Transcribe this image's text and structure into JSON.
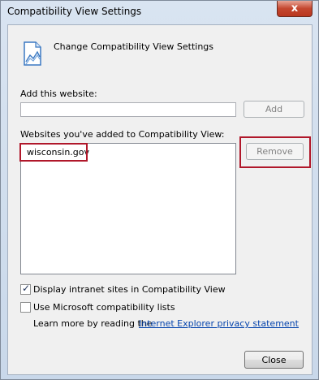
{
  "window": {
    "title": "Compatibility View Settings",
    "close_glyph": "x"
  },
  "header": {
    "icon": "compatibility-icon",
    "title": "Change Compatibility View Settings"
  },
  "add_website": {
    "label": "Add this website:",
    "value": "",
    "add_button": "Add"
  },
  "websites": {
    "label": "Websites you've added to Compatibility View:",
    "items": [
      "wisconsin.gov"
    ],
    "remove_button": "Remove"
  },
  "options": {
    "intranet": {
      "label": "Display intranet sites in Compatibility View",
      "checked": true
    },
    "ms_lists": {
      "label": "Use Microsoft compatibility lists",
      "checked": false
    }
  },
  "learn_more": {
    "text": "Learn more by reading the",
    "link": "Internet Explorer privacy statement"
  },
  "footer": {
    "close_button": "Close"
  },
  "colors": {
    "highlight": "#b0172a",
    "link": "#0645ad"
  }
}
